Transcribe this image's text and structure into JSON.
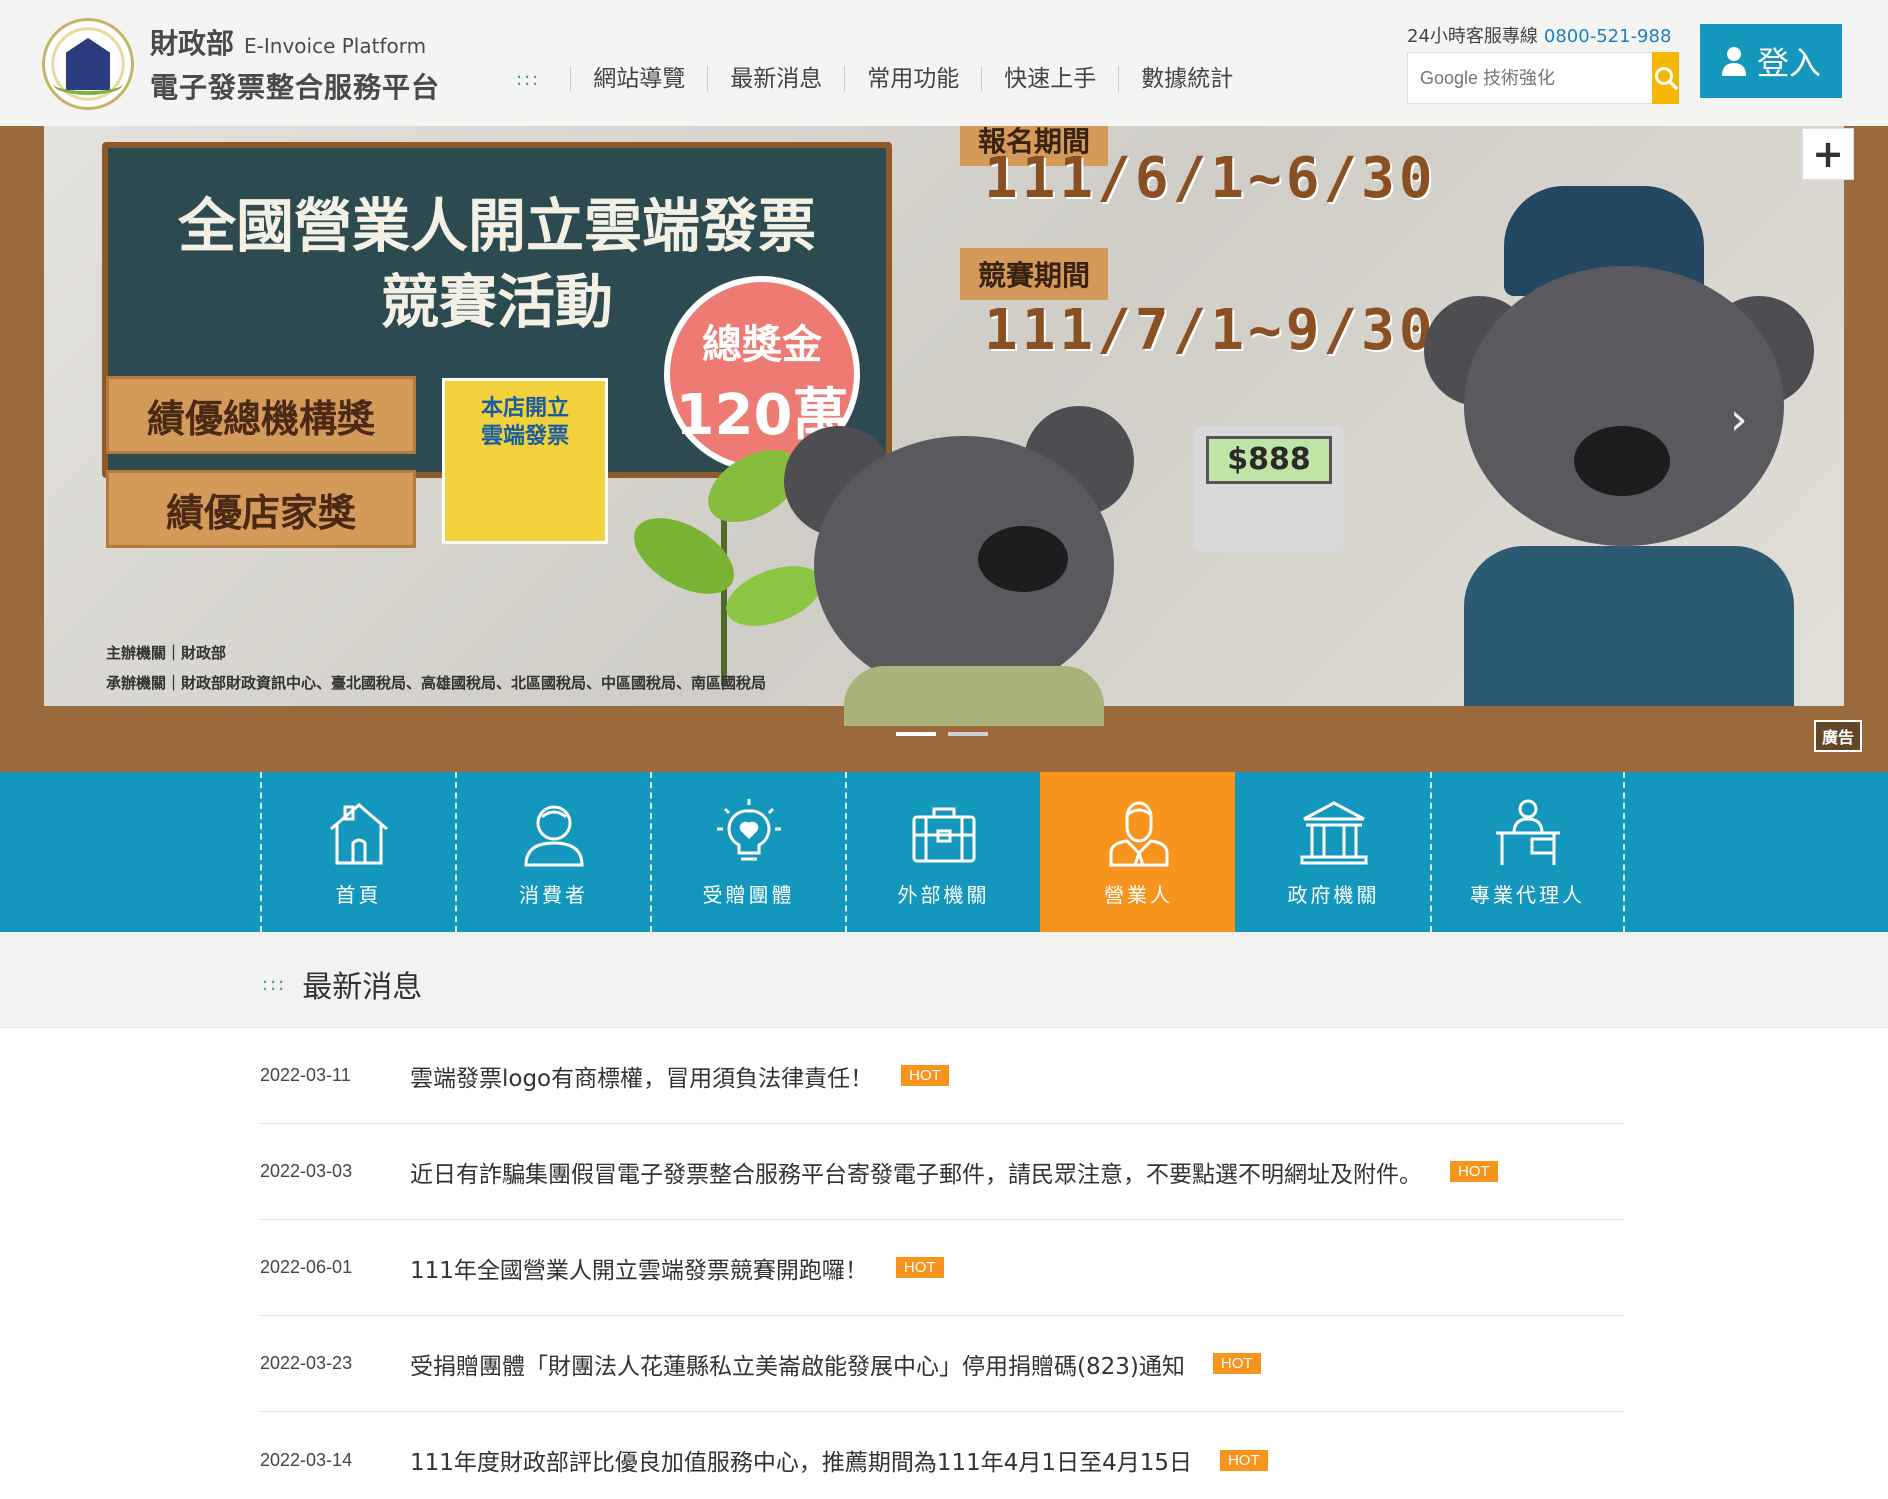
{
  "header": {
    "logo_mof": "財政部",
    "logo_en": "E-Invoice Platform",
    "logo_zh": "電子發票整合服務平台",
    "nav_dots": ":::",
    "nav": [
      "網站導覽",
      "最新消息",
      "常用功能",
      "快速上手",
      "數據統計"
    ],
    "hotline_label": "24小時客服專線",
    "hotline_number": "0800-521-988",
    "search_placeholder": "Google 技術強化",
    "login_label": "登入"
  },
  "banner": {
    "title_line1": "全國營業人開立雲端發票",
    "title_line2": "競賽活動",
    "prize_label": "總獎金",
    "prize_amount": "120萬",
    "award1": "績優總機構獎",
    "award2": "績優店家獎",
    "sticker_text_1": "本店開立",
    "sticker_text_2": "雲端發票",
    "register_tag": "報名期間",
    "register_date": "111/6/1~6/30",
    "contest_tag": "競賽期間",
    "contest_date": "111/7/1~9/30",
    "register_screen": "$888",
    "sponsor_line1": "主辦機關｜財政部",
    "sponsor_line2": "承辦機關｜財政部財政資訊中心、臺北國稅局、高雄國稅局、北區國稅局、中區國稅局、南區國稅局",
    "ad_label": "廣告"
  },
  "categories": [
    {
      "label": "首頁",
      "icon": "house-icon"
    },
    {
      "label": "消費者",
      "icon": "person-icon"
    },
    {
      "label": "受贈團體",
      "icon": "lightbulb-heart-icon"
    },
    {
      "label": "外部機關",
      "icon": "briefcase-icon"
    },
    {
      "label": "營業人",
      "icon": "businessman-icon"
    },
    {
      "label": "政府機關",
      "icon": "government-building-icon"
    },
    {
      "label": "專業代理人",
      "icon": "desk-agent-icon"
    }
  ],
  "news": {
    "title": "最新消息",
    "hot_label": "HOT",
    "items": [
      {
        "date": "2022-03-11",
        "text": "雲端發票logo有商標權，冒用須負法律責任！"
      },
      {
        "date": "2022-03-03",
        "text": "近日有詐騙集團假冒電子發票整合服務平台寄發電子郵件，請民眾注意，不要點選不明網址及附件。"
      },
      {
        "date": "2022-06-01",
        "text": "111年全國營業人開立雲端發票競賽開跑囉！"
      },
      {
        "date": "2022-03-23",
        "text": "受捐贈團體「財團法人花蓮縣私立美崙啟能發展中心」停用捐贈碼(823)通知"
      },
      {
        "date": "2022-03-14",
        "text": "111年度財政部評比優良加值服務中心，推薦期間為111年4月1日至4月15日"
      }
    ]
  },
  "colors": {
    "primary": "#1497bd",
    "accent": "#f7941d",
    "search_button": "#f5b700"
  }
}
